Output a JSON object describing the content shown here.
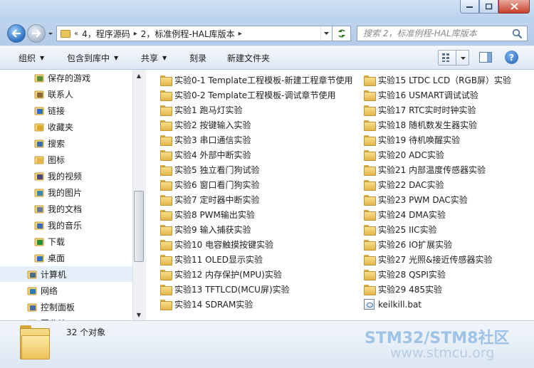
{
  "window": {
    "controls": {
      "minimize_icon": "minimize-icon",
      "maximize_icon": "maximize-icon",
      "close_icon": "close-icon"
    }
  },
  "address": {
    "overflow": "«",
    "crumbs": [
      "4，程序源码",
      "2，标准例程-HAL库版本"
    ]
  },
  "search": {
    "placeholder": "搜索 2，标准例程-HAL库版本"
  },
  "toolbar": {
    "organize": "组织",
    "include_in_library": "包含到库中",
    "share": "共享",
    "burn": "刻录",
    "new_folder": "新建文件夹"
  },
  "nav": {
    "items": [
      {
        "label": "保存的游戏",
        "icon": "saved-games-icon"
      },
      {
        "label": "联系人",
        "icon": "contacts-icon"
      },
      {
        "label": "链接",
        "icon": "links-icon"
      },
      {
        "label": "收藏夹",
        "icon": "favorites-icon"
      },
      {
        "label": "搜索",
        "icon": "searches-icon"
      },
      {
        "label": "图标",
        "icon": "folder-icon"
      },
      {
        "label": "我的视频",
        "icon": "videos-icon"
      },
      {
        "label": "我的图片",
        "icon": "pictures-icon"
      },
      {
        "label": "我的文档",
        "icon": "documents-icon"
      },
      {
        "label": "我的音乐",
        "icon": "music-icon"
      },
      {
        "label": "下载",
        "icon": "downloads-icon"
      },
      {
        "label": "桌面",
        "icon": "desktop-icon"
      },
      {
        "label": "计算机",
        "icon": "computer-icon"
      },
      {
        "label": "网络",
        "icon": "network-icon"
      },
      {
        "label": "控制面板",
        "icon": "control-panel-icon"
      },
      {
        "label": "回收站",
        "icon": "recycle-bin-icon"
      }
    ]
  },
  "files": {
    "col1": [
      "实验0-1 Template工程模板-新建工程章节使用",
      "实验0-2 Template工程模板-调试章节使用",
      "实验1 跑马灯实验",
      "实验2 按键输入实验",
      "实验3 串口通信实验",
      "实验4 外部中断实验",
      "实验5 独立看门狗试验",
      "实验6 窗口看门狗实验",
      "实验7 定时器中断实验",
      "实验8 PWM输出实验",
      "实验9 输入捕获实验",
      "实验10 电容触摸按键实验",
      "实验11 OLED显示实验",
      "实验12 内存保护(MPU)实验",
      "实验13 TFTLCD(MCU屏)实验",
      "实验14 SDRAM实验"
    ],
    "col2": [
      "实验15 LTDC LCD（RGB屏）实验",
      "实验16 USMART调试试验",
      "实验17 RTC实时时钟实验",
      "实验18 随机数发生器实验",
      "实验19 待机唤醒实验",
      "实验20 ADC实验",
      "实验21 内部温度传感器实验",
      "实验22 DAC实验",
      "实验23 PWM DAC实验",
      "实验24 DMA实验",
      "实验25 IIC实验",
      "实验26 IO扩展实验",
      "实验27 光照&接近传感器实验",
      "实验28 QSPI实验",
      "实验29 485实验",
      "keilkill.bat"
    ]
  },
  "details": {
    "count": "32 个对象"
  },
  "watermark": {
    "line1": "STM32/STM8社区",
    "line2": "www.stmcu.org"
  }
}
